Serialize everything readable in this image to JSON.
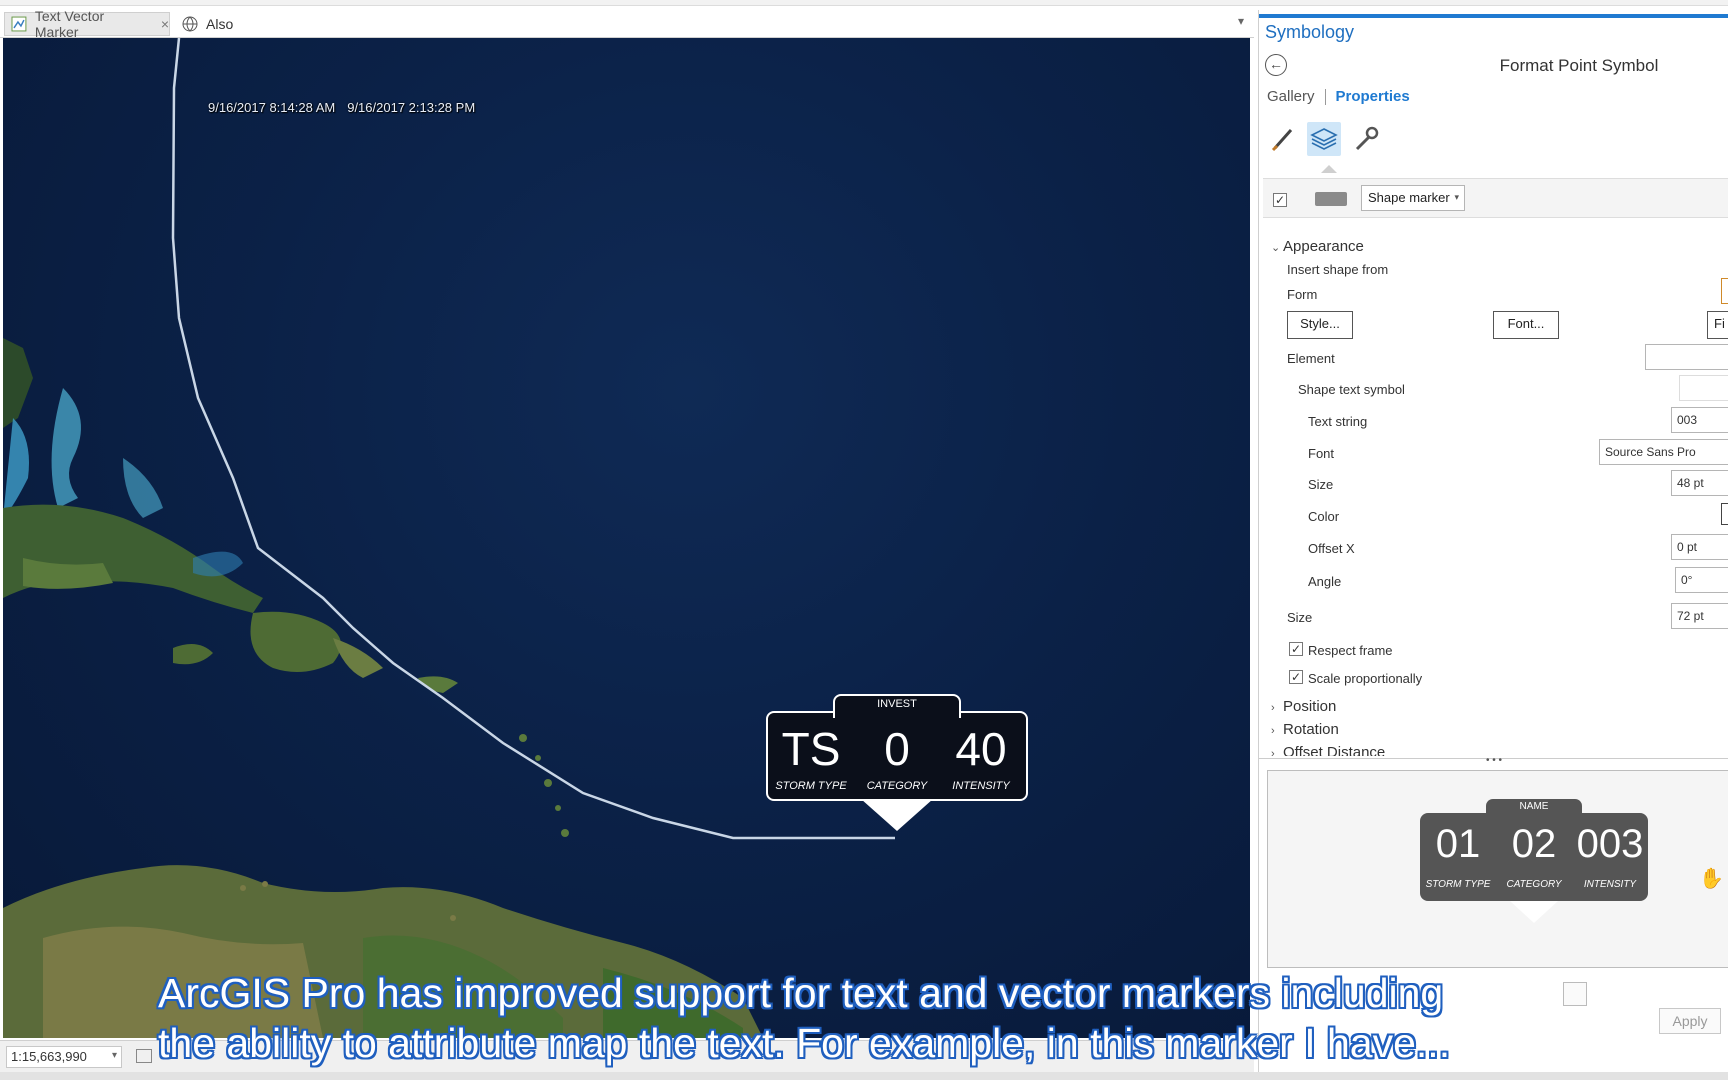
{
  "tabs": [
    {
      "label": "Text Vector Marker",
      "close": "×"
    },
    {
      "label": "Also"
    }
  ],
  "map": {
    "time_start": "9/16/2017 8:14:28 AM",
    "time_end": "9/16/2017 2:13:28 PM",
    "marker": {
      "header": "INVEST",
      "storm_type": "TS",
      "category": "0",
      "intensity": "40",
      "storm_type_label": "STORM TYPE",
      "category_label": "CATEGORY",
      "intensity_label": "INTENSITY"
    }
  },
  "status": {
    "scale": "1:15,663,990"
  },
  "pane": {
    "title": "Symbology",
    "subtitle": "Format Point Symbol",
    "tab_gallery": "Gallery",
    "tab_properties": "Properties",
    "layer_type": "Shape marker",
    "appearance": "Appearance",
    "insert_shape_from": "Insert shape from",
    "form": "Form",
    "style_btn": "Style...",
    "font_btn": "Font...",
    "file_btn": "Fi",
    "element": "Element",
    "shape_text_symbol": "Shape text symbol",
    "text_string_label": "Text string",
    "text_string_value": "003",
    "font_label": "Font",
    "font_value": "Source Sans Pro",
    "size_label": "Size",
    "size_value": "48 pt",
    "color_label": "Color",
    "offset_x_label": "Offset X",
    "offset_x_value": "0 pt",
    "angle_label": "Angle",
    "angle_value": "0°",
    "size2_label": "Size",
    "size2_value": "72 pt",
    "respect_frame": "Respect frame",
    "scale_proportionally": "Scale proportionally",
    "position": "Position",
    "rotation": "Rotation",
    "offset_distance": "Offset Distance",
    "apply": "Apply",
    "preview": {
      "header": "NAME",
      "v1": "01",
      "v2": "02",
      "v3": "003",
      "l1": "STORM TYPE",
      "l2": "CATEGORY",
      "l3": "INTENSITY"
    }
  },
  "caption": {
    "line1": "ArcGIS Pro has improved support for text and vector markers including",
    "line2": "the ability to attribute map the text. For example, in this marker I have..."
  }
}
